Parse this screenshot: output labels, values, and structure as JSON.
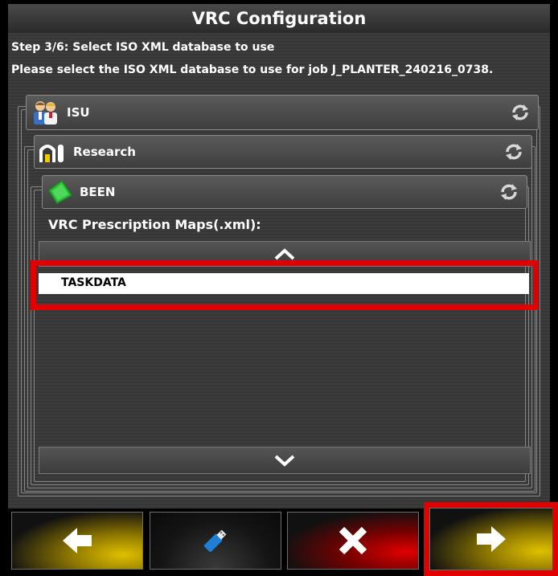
{
  "window": {
    "title": "VRC Configuration"
  },
  "step": {
    "title": "Step 3/6: Select ISO XML database to use",
    "instruction": "Please select the ISO XML database to use for job J_PLANTER_240216_0738."
  },
  "hierarchy": {
    "client": {
      "label": "ISU",
      "icon": "client-icon"
    },
    "farm": {
      "label": "Research",
      "icon": "farm-icon"
    },
    "field": {
      "label": "BEEN",
      "icon": "field-icon"
    }
  },
  "maps": {
    "label": "VRC Prescription Maps(.xml):",
    "items": [
      "TASKDATA"
    ]
  },
  "buttons": {
    "back": "back-arrow-icon",
    "usb": "usb-drive-icon",
    "cancel": "cancel-x-icon",
    "next": "next-arrow-icon"
  },
  "colors": {
    "highlight": "#e00000",
    "back_accent": "#c8a800",
    "cancel_accent": "#d40000",
    "next_accent": "#c8a800"
  }
}
